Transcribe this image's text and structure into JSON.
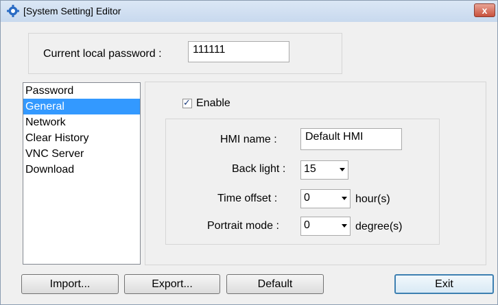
{
  "window": {
    "title": "[System Setting] Editor",
    "close_label": "x"
  },
  "password": {
    "label": "Current local password :",
    "value": "111111"
  },
  "sidebar": {
    "items": [
      {
        "label": "Password"
      },
      {
        "label": "General",
        "selected": true
      },
      {
        "label": "Network"
      },
      {
        "label": "Clear History"
      },
      {
        "label": "VNC Server"
      },
      {
        "label": "Download"
      }
    ]
  },
  "general": {
    "enable_label": "Enable",
    "enable_checked": true,
    "hmi_name_label": "HMI name :",
    "hmi_name_value": "Default HMI",
    "back_light_label": "Back light :",
    "back_light_value": "15",
    "time_offset_label": "Time offset :",
    "time_offset_value": "0",
    "time_offset_unit": "hour(s)",
    "portrait_mode_label": "Portrait mode :",
    "portrait_mode_value": "0",
    "portrait_mode_unit": "degree(s)"
  },
  "buttons": {
    "import_label": "Import...",
    "export_label": "Export...",
    "default_label": "Default",
    "exit_label": "Exit"
  },
  "colors": {
    "selection": "#3399ff",
    "titlebar": "#c8d9ee"
  }
}
